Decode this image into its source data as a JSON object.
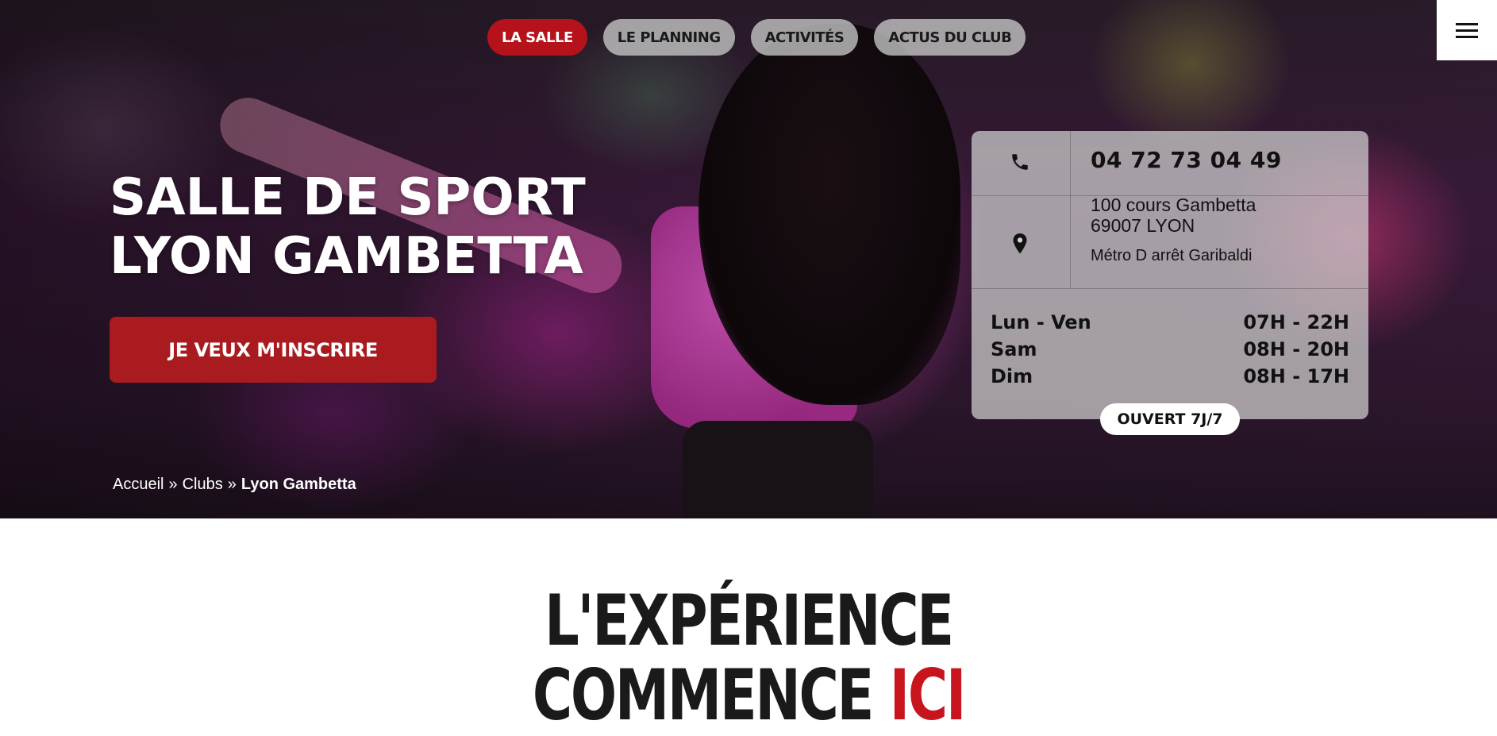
{
  "nav": {
    "items": [
      {
        "label": "LA SALLE",
        "active": true
      },
      {
        "label": "LE PLANNING",
        "active": false
      },
      {
        "label": "ACTIVITÉS",
        "active": false
      },
      {
        "label": "ACTUS DU CLUB",
        "active": false
      }
    ],
    "menu_icon": "hamburger-icon"
  },
  "hero": {
    "title_line1": "SALLE DE SPORT",
    "title_line2": "LYON GAMBETTA",
    "cta_label": "JE VEUX M'INSCRIRE",
    "breadcrumb": {
      "home": "Accueil",
      "separator": "»",
      "clubs": "Clubs",
      "current": "Lyon Gambetta"
    }
  },
  "info": {
    "phone_icon": "phone-icon",
    "phone": "04 72 73 04 49",
    "location_icon": "map-pin-icon",
    "address_line1": "100 cours Gambetta",
    "address_line2": "69007 LYON",
    "metro": "Métro D arrêt Garibaldi",
    "hours": [
      {
        "days": "Lun - Ven",
        "time": "07H - 22H"
      },
      {
        "days": "Sam",
        "time": "08H - 20H"
      },
      {
        "days": "Dim",
        "time": "08H - 17H"
      }
    ],
    "open_badge": "OUVERT 7J/7"
  },
  "section": {
    "title_line1": "L'EXPÉRIENCE",
    "title_line2_main": "COMMENCE ",
    "title_line2_accent": "ICI"
  },
  "colors": {
    "brand_red": "#b5121b",
    "accent_red": "#c8151d"
  }
}
